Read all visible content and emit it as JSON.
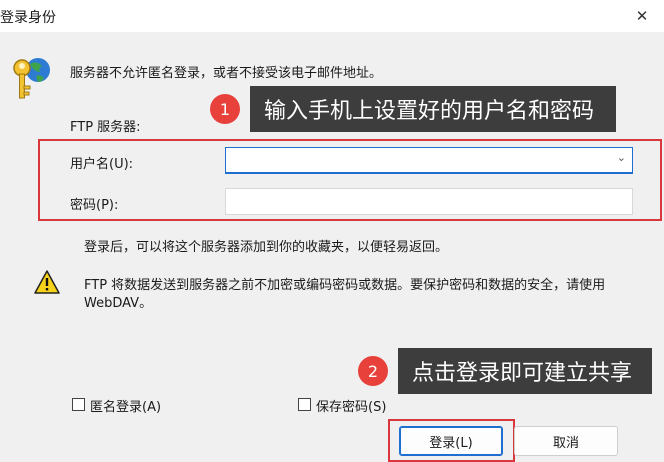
{
  "window": {
    "title": "登录身份",
    "close_glyph": "✕"
  },
  "message": "服务器不允许匿名登录，或者不接受该电子邮件地址。",
  "ftp_server_label": "FTP 服务器:",
  "username": {
    "label": "用户名(U):",
    "value": ""
  },
  "password": {
    "label": "密码(P):",
    "value": ""
  },
  "info_text": "登录后，可以将这个服务器添加到你的收藏夹，以便轻易返回。",
  "warning_lines": [
    "FTP 将数据发送到服务器之前不加密或编码密码或数据。要保护密码和数据的安全，请使用",
    "WebDAV。"
  ],
  "anonymous_label": "匿名登录(A)",
  "save_password_label": "保存密码(S)",
  "buttons": {
    "login": "登录(L)",
    "cancel": "取消"
  },
  "callouts": [
    {
      "num": "1",
      "text": "输入手机上设置好的用户名和密码"
    },
    {
      "num": "2",
      "text": "点击登录即可建立共享"
    }
  ],
  "colors": {
    "accent": "#1f6fd0",
    "highlight": "#d9363e",
    "callout_bg": "#3d3d3d",
    "badge": "#e8413c"
  }
}
